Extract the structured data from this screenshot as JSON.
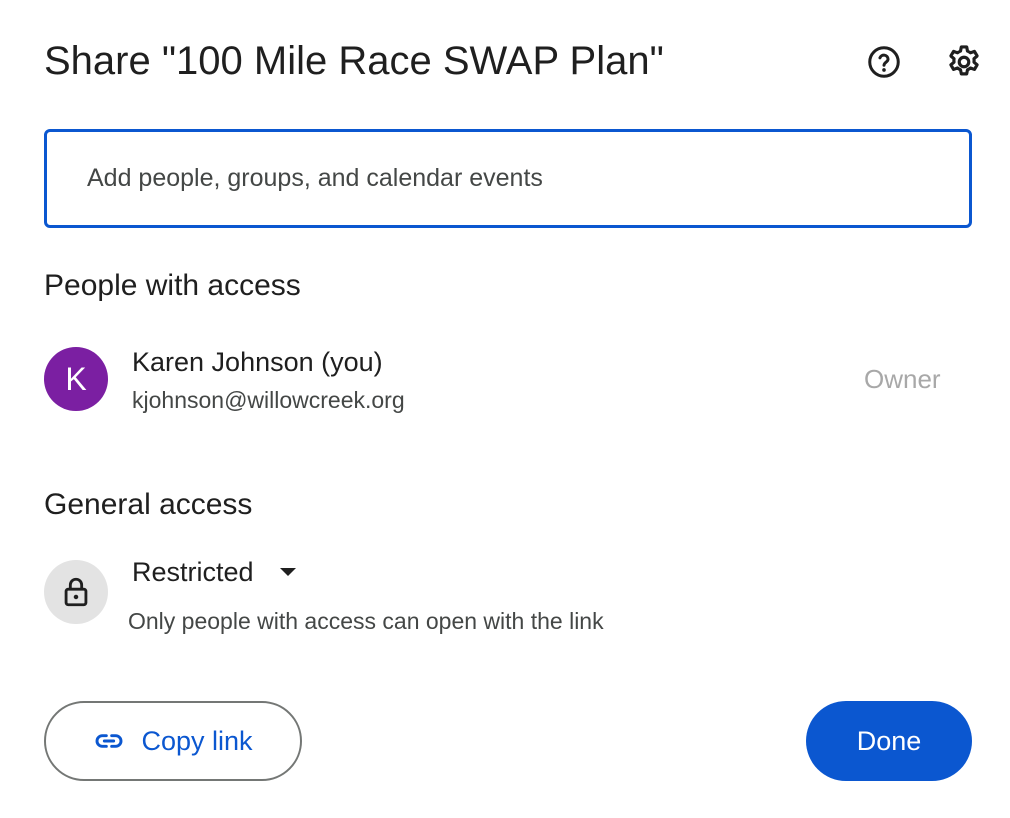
{
  "dialog": {
    "title": "Share \"100 Mile Race SWAP Plan\"",
    "help_icon": "help-circle-icon",
    "settings_icon": "gear-icon"
  },
  "add_people": {
    "placeholder": "Add people, groups, and calendar events"
  },
  "people_section": {
    "title": "People with access",
    "people": [
      {
        "initial": "K",
        "name": "Karen Johnson (you)",
        "email": "kjohnson@willowcreek.org",
        "role": "Owner",
        "avatar_color": "#7b1fa2"
      }
    ]
  },
  "general_access": {
    "title": "General access",
    "icon": "lock-icon",
    "selected": "Restricted",
    "description": "Only people with access can open with the link"
  },
  "footer": {
    "copy_link_label": "Copy link",
    "copy_link_icon": "link-icon",
    "done_label": "Done"
  },
  "colors": {
    "accent": "#0b57d0",
    "owner_role": "#a8a8a8"
  }
}
